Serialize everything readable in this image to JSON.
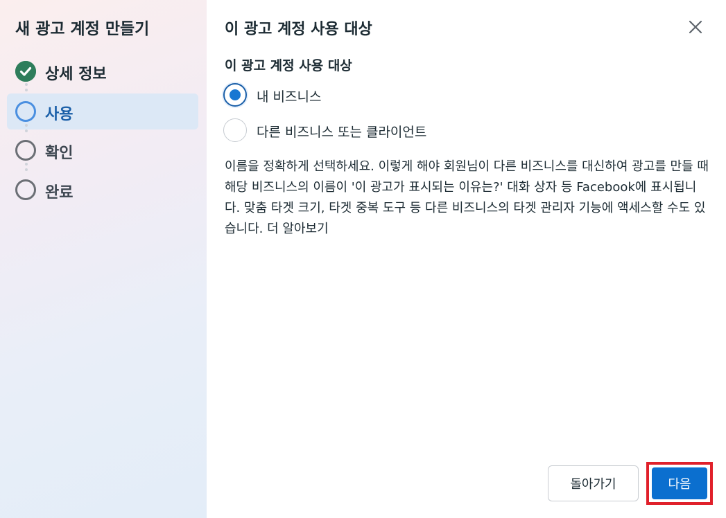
{
  "sidebar": {
    "title": "새 광고 계정 만들기",
    "steps": [
      {
        "label": "상세 정보",
        "state": "completed"
      },
      {
        "label": "사용",
        "state": "current"
      },
      {
        "label": "확인",
        "state": "pending"
      },
      {
        "label": "완료",
        "state": "pending"
      }
    ]
  },
  "main": {
    "title": "이 광고 계정 사용 대상",
    "close_icon": "close-icon",
    "section_title": "이 광고 계정 사용 대상",
    "options": [
      {
        "label": "내 비즈니스",
        "selected": true
      },
      {
        "label": "다른 비즈니스 또는 클라이언트",
        "selected": false
      }
    ],
    "description": "이름을 정확하게 선택하세요. 이렇게 해야 회원님이 다른 비즈니스를 대신하여 광고를 만들 때 해당 비즈니스의 이름이 '이 광고가 표시되는 이유는?' 대화 상자 등 Facebook에 표시됩니다. 맞춤 타겟 크기, 타겟 중복 도구 등 다른 비즈니스의 타겟 관리자 기능에 액세스할 수도 있습니다.",
    "learn_more": "더 알아보기"
  },
  "footer": {
    "back_label": "돌아가기",
    "next_label": "다음"
  },
  "colors": {
    "accent": "#1877d2",
    "completed": "#2e8b57",
    "highlight_border": "#e0202a"
  }
}
